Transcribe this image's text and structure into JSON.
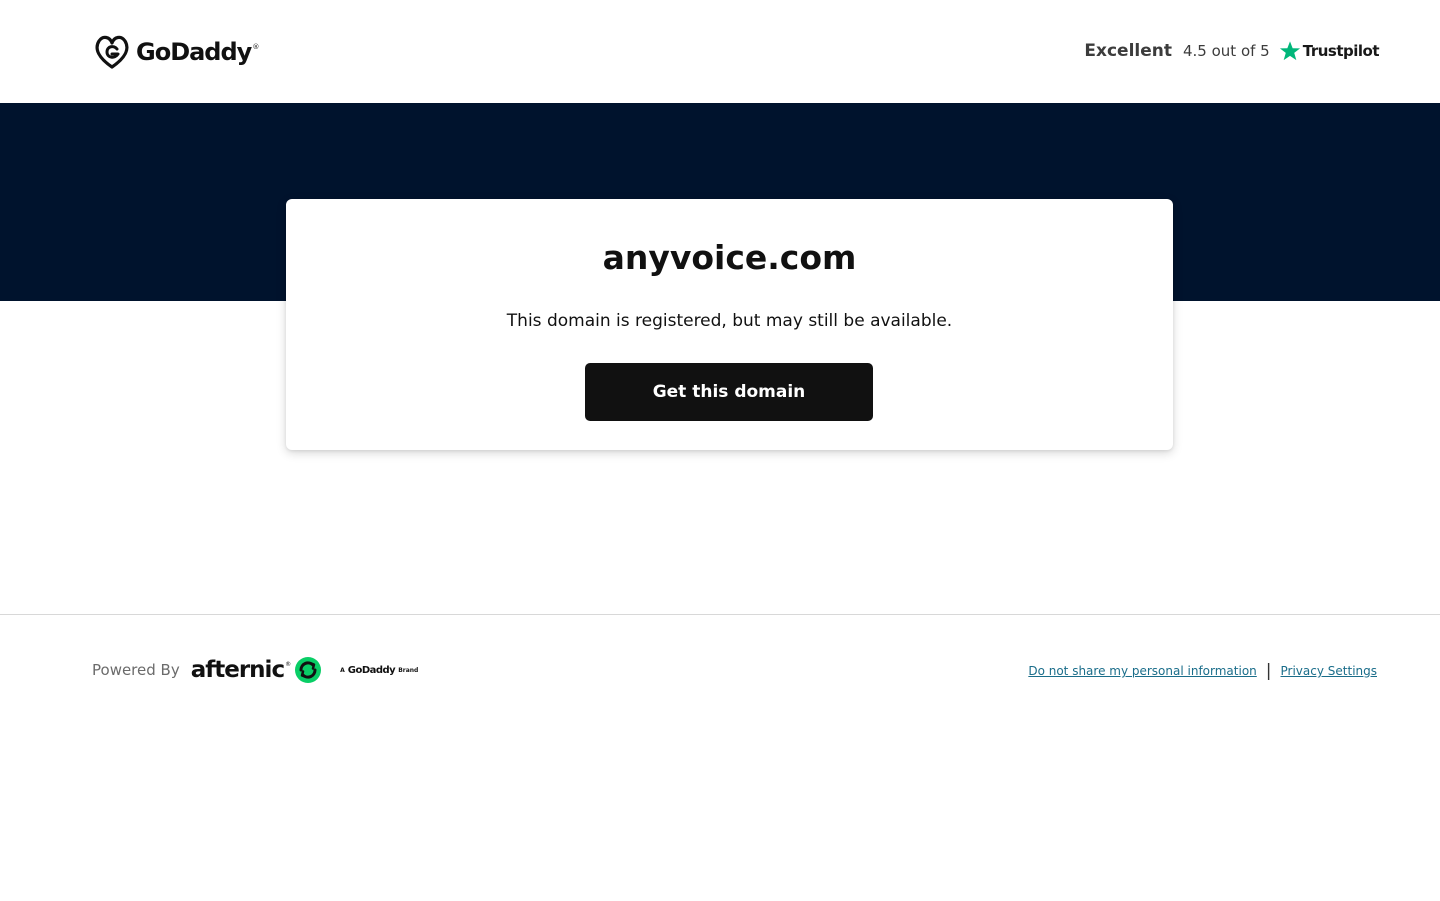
{
  "header": {
    "logo_text": "GoDaddy",
    "rating_word": "Excellent",
    "rating_score": "4.5 out of 5",
    "rating_provider": "Trustpilot",
    "rating_star_color": "#00b67a"
  },
  "hero": {
    "band_color": "#00132d"
  },
  "card": {
    "domain": "anyvoice.com",
    "message": "This domain is registered, but may still be available.",
    "cta_label": "Get this domain"
  },
  "footer": {
    "powered_by": "Powered By",
    "partner_name": "afternic",
    "partner_mark_color": "#09ce66",
    "brand_prefix": "A",
    "brand_name": "GoDaddy",
    "brand_suffix": "Brand",
    "links": [
      {
        "label": "Do not share my personal information"
      },
      {
        "label": "Privacy Settings"
      }
    ],
    "separator": "|"
  },
  "icons": {
    "logo": "godaddy-logo-icon",
    "star": "trustpilot-star-icon",
    "afternic": "afternic-logo-icon"
  }
}
